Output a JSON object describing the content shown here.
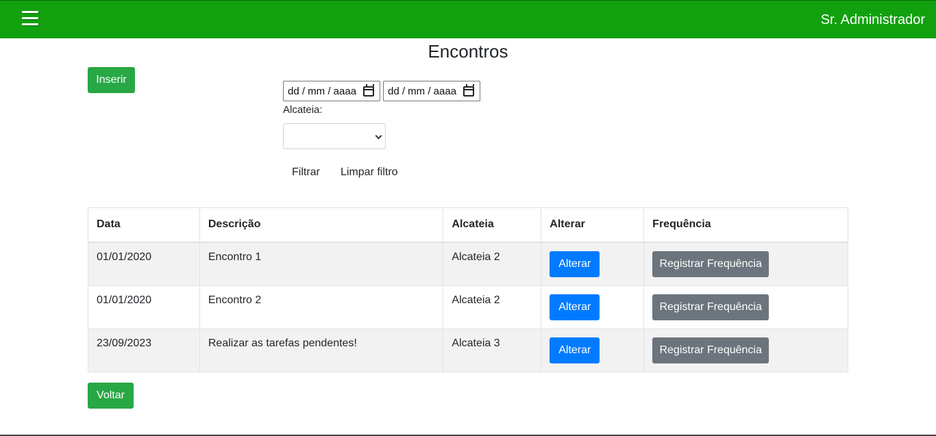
{
  "header": {
    "user_name": "Sr. Administrador",
    "menu_icon": "hamburger-menu-icon",
    "bar_color": "#12a10e"
  },
  "page": {
    "title": "Encontros"
  },
  "toolbar": {
    "insert_label": "Inserir",
    "back_label": "Voltar"
  },
  "filters": {
    "date_from_placeholder": "dd / mm / aaaa",
    "date_to_placeholder": "dd / mm / aaaa",
    "calendar_icon": "calendar-icon",
    "alcateia_label": "Alcateia:",
    "alcateia_selected": "",
    "filter_label": "Filtrar",
    "clear_label": "Limpar filtro"
  },
  "table": {
    "headers": [
      "Data",
      "Descrição",
      "Alcateia",
      "Alterar",
      "Frequência"
    ],
    "rows": [
      {
        "date": "01/01/2020",
        "description": "Encontro 1",
        "alcateia": "Alcateia 2",
        "alter_label": "Alterar",
        "freq_label": "Registrar Frequência"
      },
      {
        "date": "01/01/2020",
        "description": "Encontro 2",
        "alcateia": "Alcateia 2",
        "alter_label": "Alterar",
        "freq_label": "Registrar Frequência"
      },
      {
        "date": "23/09/2023",
        "description": "Realizar as tarefas pendentes!",
        "alcateia": "Alcateia 3",
        "alter_label": "Alterar",
        "freq_label": "Registrar Frequência"
      }
    ]
  },
  "colors": {
    "success": "#28a745",
    "primary": "#007bff",
    "secondary": "#6c757d",
    "striped_row": "#f2f2f2"
  }
}
